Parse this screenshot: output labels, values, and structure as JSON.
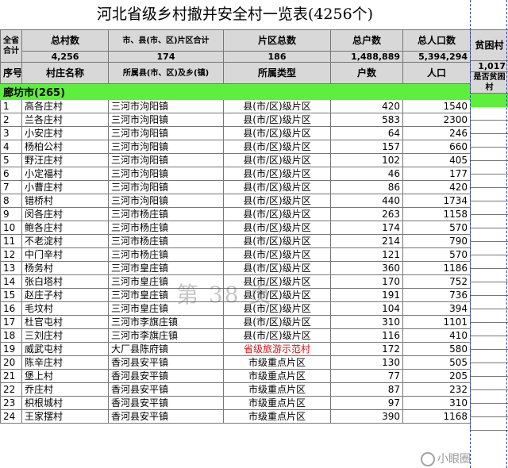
{
  "title": "河北省级乡村撤并安全村一览表(4256个)",
  "summary_header": {
    "col0": "全省合计",
    "col1": "总村数",
    "col2": "市、县(市、区)片区合计",
    "col3": "片区总数",
    "col4": "总户数",
    "col5": "总人口数",
    "col6": "贫困村"
  },
  "summary_values": {
    "total_villages": "4,256",
    "county_area_total": "174",
    "area_total": "186",
    "total_households": "1,488,889",
    "total_population": "5,394,294",
    "poor_villages": "1,017"
  },
  "columns": {
    "no": "序号",
    "village": "村庄名称",
    "county_town": "所属县(市、区)及乡(镇)",
    "area_type": "所属类型",
    "households": "户数",
    "population": "人口",
    "poor": "是否贫困村"
  },
  "region": {
    "label": "廊坊市(265)"
  },
  "rows": [
    {
      "no": "1",
      "village": "高各庄村",
      "town": "三河市泃阳镇",
      "type": "县(市/区)级片区",
      "households": "420",
      "population": "1540"
    },
    {
      "no": "2",
      "village": "兰各庄村",
      "town": "三河市泃阳镇",
      "type": "县(市/区)级片区",
      "households": "583",
      "population": "2300"
    },
    {
      "no": "3",
      "village": "小安庄村",
      "town": "三河市泃阳镇",
      "type": "县(市/区)级片区",
      "households": "64",
      "population": "246"
    },
    {
      "no": "4",
      "village": "杨柏公村",
      "town": "三河市泃阳镇",
      "type": "县(市/区)级片区",
      "households": "157",
      "population": "660"
    },
    {
      "no": "5",
      "village": "野汪庄村",
      "town": "三河市泃阳镇",
      "type": "县(市/区)级片区",
      "households": "102",
      "population": "405"
    },
    {
      "no": "6",
      "village": "小定福村",
      "town": "三河市泃阳镇",
      "type": "县(市/区)级片区",
      "households": "46",
      "population": "177"
    },
    {
      "no": "7",
      "village": "小曹庄村",
      "town": "三河市泃阳镇",
      "type": "县(市/区)级片区",
      "households": "86",
      "population": "420"
    },
    {
      "no": "8",
      "village": "错桥村",
      "town": "三河市泃阳镇",
      "type": "县(市/区)级片区",
      "households": "440",
      "population": "1734"
    },
    {
      "no": "9",
      "village": "闵各庄村",
      "town": "三河市杨庄镇",
      "type": "县(市/区)级片区",
      "households": "263",
      "population": "1158"
    },
    {
      "no": "10",
      "village": "鲍各庄村",
      "town": "三河市杨庄镇",
      "type": "县(市/区)级片区",
      "households": "174",
      "population": "570"
    },
    {
      "no": "11",
      "village": "不老淀村",
      "town": "三河市杨庄镇",
      "type": "县(市/区)级片区",
      "households": "214",
      "population": "790"
    },
    {
      "no": "12",
      "village": "中门辛村",
      "town": "三河市杨庄镇",
      "type": "县(市/区)级片区",
      "households": "121",
      "population": "570"
    },
    {
      "no": "13",
      "village": "杨务村",
      "town": "三河市皇庄镇",
      "type": "县(市/区)级片区",
      "households": "360",
      "population": "1186"
    },
    {
      "no": "14",
      "village": "张白塔村",
      "town": "三河市皇庄镇",
      "type": "县(市/区)级片区",
      "households": "170",
      "population": "752"
    },
    {
      "no": "15",
      "village": "赵庄子村",
      "town": "三河市皇庄镇",
      "type": "县(市/区)级片区",
      "households": "191",
      "population": "736"
    },
    {
      "no": "16",
      "village": "毛坟村",
      "town": "三河市皇庄镇",
      "type": "县(市/区)级片区",
      "households": "104",
      "population": "394"
    },
    {
      "no": "17",
      "village": "杜官屯村",
      "town": "三河市李旗庄镇",
      "type": "县(市/区)级片区",
      "households": "310",
      "population": "1101"
    },
    {
      "no": "18",
      "village": "三刘庄村",
      "town": "三河市李旗庄镇",
      "type": "县(市/区)级片区",
      "households": "116",
      "population": "410"
    },
    {
      "no": "19",
      "village": "威武屯村",
      "town": "大厂县陈府镇",
      "type": "省级旅游示范村",
      "households": "172",
      "population": "580",
      "highlight": true
    },
    {
      "no": "20",
      "village": "陈辛庄村",
      "town": "香河县安平镇",
      "type": "市级重点片区",
      "households": "130",
      "population": "505"
    },
    {
      "no": "21",
      "village": "堡上村",
      "town": "香河县安平镇",
      "type": "市级重点片区",
      "households": "77",
      "population": "205"
    },
    {
      "no": "22",
      "village": "乔庄村",
      "town": "香河县安平镇",
      "type": "市级重点片区",
      "households": "87",
      "population": "232"
    },
    {
      "no": "23",
      "village": "枳根城村",
      "town": "香河县安平镇",
      "type": "市级重点片区",
      "households": "97",
      "population": "310"
    },
    {
      "no": "24",
      "village": "王家摆村",
      "town": "香河县安平镇",
      "type": "市级重点片区",
      "households": "390",
      "population": "1168"
    }
  ],
  "watermark": "第 38 页",
  "logo_text": "小眼圈"
}
